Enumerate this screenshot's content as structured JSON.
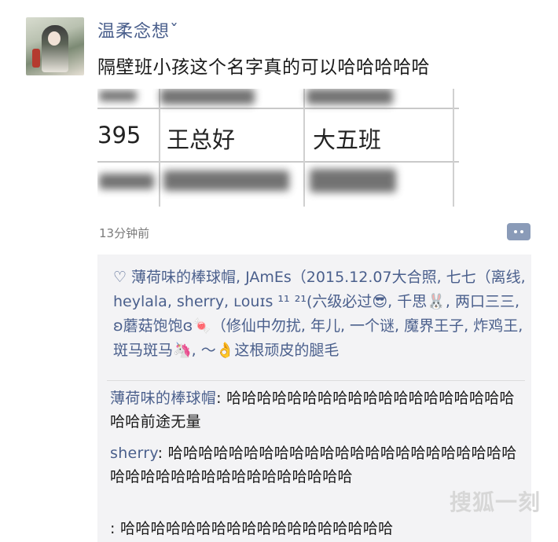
{
  "post": {
    "username": "温柔念想ˇ",
    "text": "隔壁班小孩这个名字真的可以哈哈哈哈哈",
    "photo": {
      "row_number": "395",
      "name_cell": "王总好",
      "class_cell": "大五班"
    },
    "timestamp": "13分钟前"
  },
  "likes": {
    "heart_icon": "♡",
    "text": "薄荷味的棒球帽, JAmEs（2015.12.07大合照, 七七（离线, heylala, sherry, ʟouɪs ¹¹ ²¹(六级必过😎, 千思🐰, 两口三三, ʚ蘑菇饱饱ɞ🍬（修仙中勿扰, 年儿, 一个谜, 魔界王子, 炸鸡王, 斑马斑马🦄, ～👌这根顽皮的腿毛"
  },
  "comments": [
    {
      "name": "薄荷味的棒球帽",
      "sep": ": ",
      "text": "哈哈哈哈哈哈哈哈哈哈哈哈哈哈哈哈哈哈哈哈哈前途无量"
    },
    {
      "name": "sherry",
      "sep": ": ",
      "text": "哈哈哈哈哈哈哈哈哈哈哈哈哈哈哈哈哈哈哈哈哈哈哈哈哈哈哈哈哈哈哈哈哈哈哈哈哈哈哈"
    },
    {
      "name": "",
      "sep": ": ",
      "text": "哈哈哈哈哈哈哈哈哈哈哈哈哈哈哈哈哈哈"
    }
  ],
  "watermark": "搜狐一刻",
  "colors": {
    "link": "#4a5f8c",
    "panel": "#f3f3f5",
    "comment_button": "#8a9bb8"
  }
}
